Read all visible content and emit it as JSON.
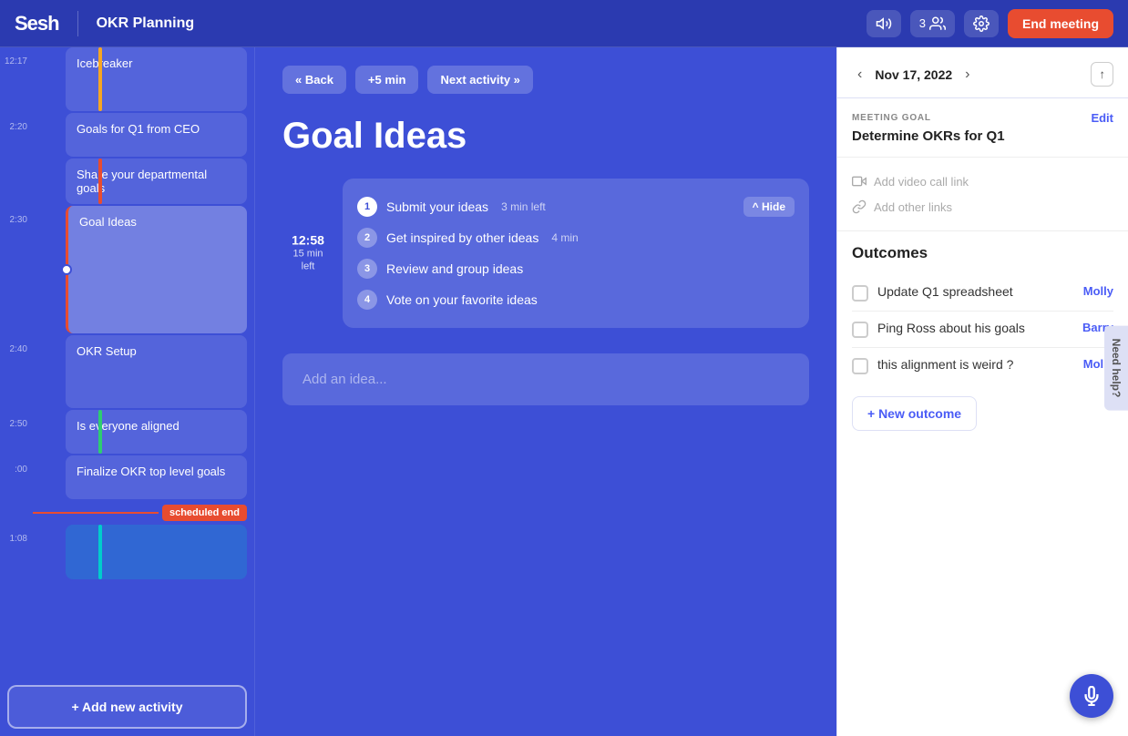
{
  "app": {
    "logo": "Sesh",
    "meeting_title": "OKR Planning"
  },
  "nav": {
    "sound_icon": "🔊",
    "participants_count": "3",
    "settings_icon": "⚙",
    "end_meeting_label": "End meeting"
  },
  "sidebar": {
    "items": [
      {
        "id": "icebreaker",
        "label": "Icebreaker",
        "time": "12:17",
        "color": "#f5a623",
        "active": false,
        "height": 70
      },
      {
        "id": "goals-ceo",
        "label": "Goals for Q1 from CEO",
        "time": "2:20",
        "color": null,
        "active": false
      },
      {
        "id": "share-goals",
        "label": "Share your departmental goals",
        "time": "",
        "color": "#e84c30",
        "active": false
      },
      {
        "id": "goal-ideas",
        "label": "Goal Ideas",
        "time": "2:30",
        "color": "#e84c30",
        "active": true
      },
      {
        "id": "okr-setup",
        "label": "OKR Setup",
        "time": "2:40",
        "color": null,
        "active": false
      },
      {
        "id": "is-aligned",
        "label": "Is everyone aligned",
        "time": "2:50",
        "color": "#2ecc71",
        "active": false
      },
      {
        "id": "finalize",
        "label": "Finalize OKR top level goals",
        "time": "",
        "color": null,
        "active": false
      }
    ],
    "scheduled_end_label": "scheduled end",
    "add_activity_label": "+ Add new activity"
  },
  "activity": {
    "back_label": "« Back",
    "plus5_label": "+5 min",
    "next_label": "Next activity »",
    "title": "Goal Ideas",
    "timer": "12:58",
    "time_left": "15 min\nleft",
    "steps": [
      {
        "num": "1",
        "label": "Submit your ideas",
        "duration": "3 min left",
        "active": true
      },
      {
        "num": "2",
        "label": "Get inspired by other ideas",
        "duration": "4 min",
        "active": false
      },
      {
        "num": "3",
        "label": "Review and group ideas",
        "duration": "",
        "active": false
      },
      {
        "num": "4",
        "label": "Vote on your favorite ideas",
        "duration": "",
        "active": false
      }
    ],
    "hide_label": "^ Hide",
    "idea_placeholder": "Add an idea..."
  },
  "right_panel": {
    "date": "Nov 17, 2022",
    "share_icon": "↑",
    "meeting_goal_section_label": "MEETING GOAL",
    "edit_label": "Edit",
    "meeting_goal": "Determine OKRs for Q1",
    "video_call_label": "Add video call link",
    "other_links_label": "Add other links",
    "outcomes_title": "Outcomes",
    "outcomes": [
      {
        "text": "Update Q1 spreadsheet",
        "assignee": "Molly",
        "checked": false
      },
      {
        "text": "Ping Ross about his goals",
        "assignee": "Barry",
        "checked": false
      },
      {
        "text": "this alignment is weird ?",
        "assignee": "Molly",
        "checked": false
      }
    ],
    "new_outcome_label": "+ New outcome"
  }
}
